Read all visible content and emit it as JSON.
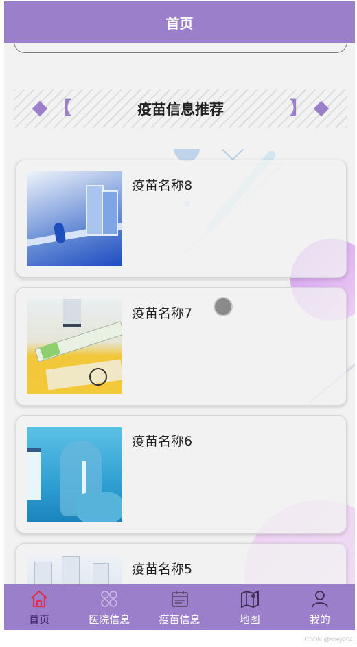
{
  "header": {
    "title": "首页"
  },
  "section": {
    "title": "疫苗信息推荐",
    "left_bracket": "【",
    "right_bracket": "】"
  },
  "vaccines": [
    {
      "name": "疫苗名称8"
    },
    {
      "name": "疫苗名称7"
    },
    {
      "name": "疫苗名称6"
    },
    {
      "name": "疫苗名称5"
    }
  ],
  "tabs": [
    {
      "label": "首页",
      "icon": "home-icon",
      "active": true
    },
    {
      "label": "医院信息",
      "icon": "grid-icon",
      "active": false
    },
    {
      "label": "疫苗信息",
      "icon": "calendar-icon",
      "active": false
    },
    {
      "label": "地图",
      "icon": "map-icon",
      "active": false
    },
    {
      "label": "我的",
      "icon": "user-icon",
      "active": false
    }
  ],
  "colors": {
    "primary": "#9b7fca",
    "active_icon": "#d9344b",
    "active_label": "#3d2566"
  },
  "watermark": "CSDN @sheji204"
}
